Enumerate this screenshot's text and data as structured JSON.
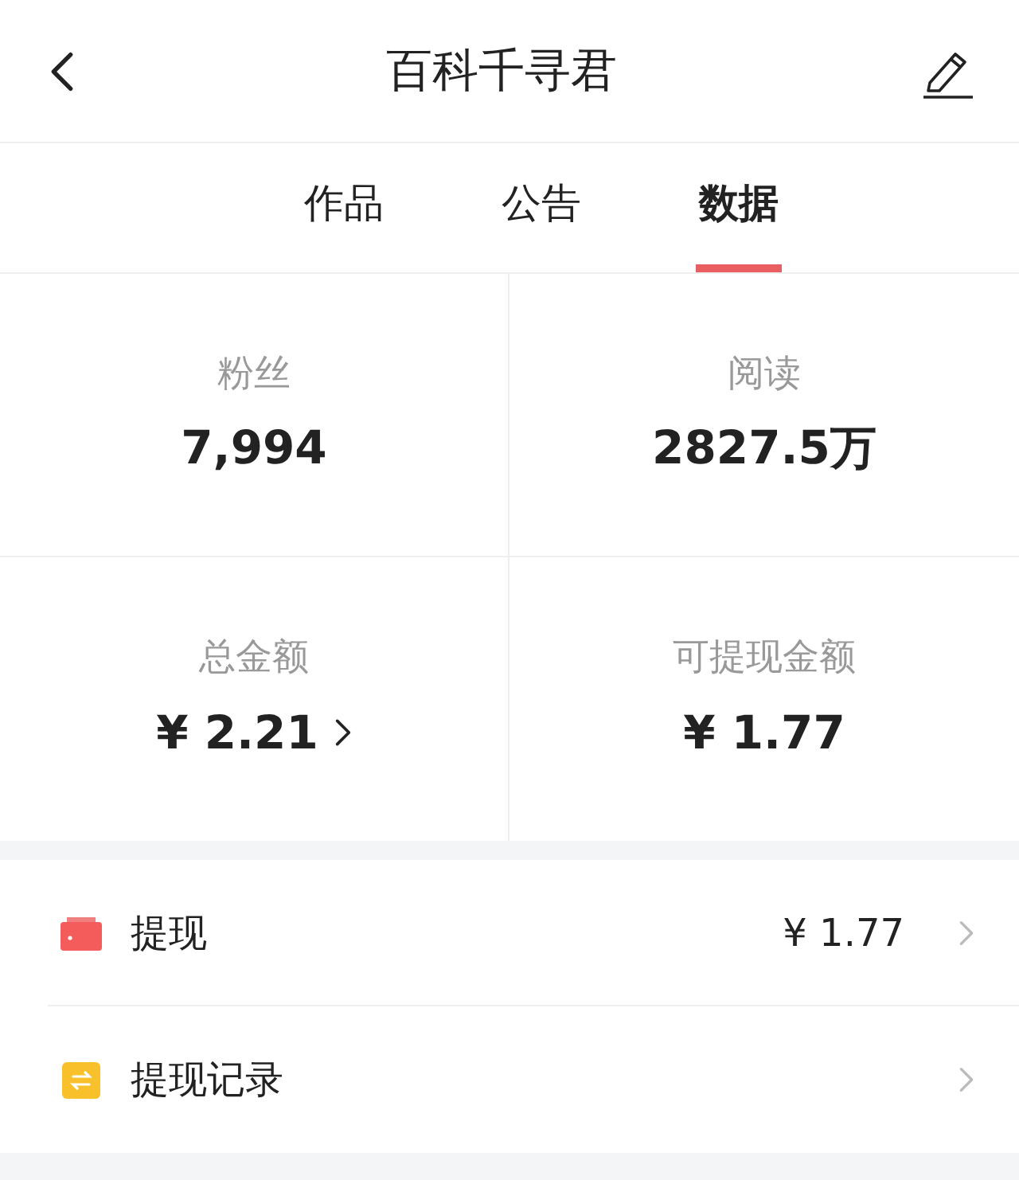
{
  "header": {
    "title": "百科千寻君"
  },
  "tabs": [
    {
      "label": "作品",
      "selected": false
    },
    {
      "label": "公告",
      "selected": false
    },
    {
      "label": "数据",
      "selected": true
    }
  ],
  "stats": [
    {
      "label": "粉丝",
      "value": "7,994",
      "arrow": false
    },
    {
      "label": "阅读",
      "value": "2827.5万",
      "arrow": false
    },
    {
      "label": "总金额",
      "value": "¥ 2.21",
      "arrow": true
    },
    {
      "label": "可提现金额",
      "value": "¥ 1.77",
      "arrow": false
    }
  ],
  "menu": [
    {
      "kind": "wallet",
      "label": "提现",
      "value": "¥ 1.77"
    },
    {
      "kind": "record",
      "label": "提现记录"
    }
  ]
}
